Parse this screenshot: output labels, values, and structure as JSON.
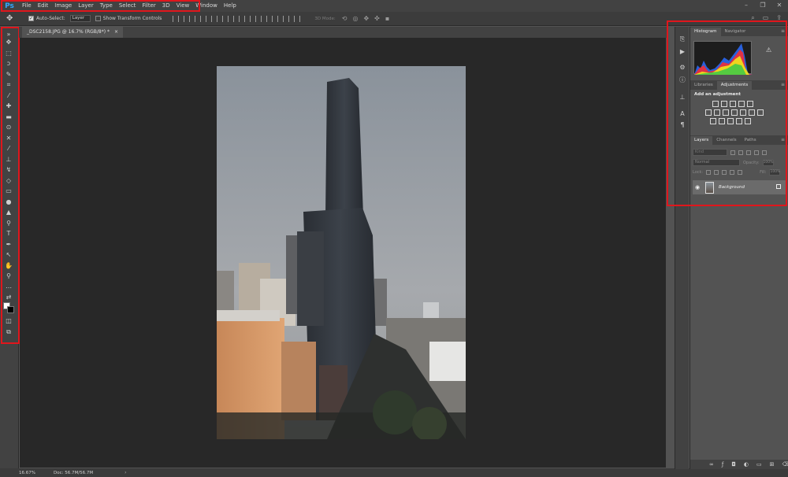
{
  "app": {
    "logo": "Ps"
  },
  "menu": [
    "File",
    "Edit",
    "Image",
    "Layer",
    "Type",
    "Select",
    "Filter",
    "3D",
    "View",
    "Window",
    "Help"
  ],
  "window_controls": [
    "–",
    "❐",
    "✕"
  ],
  "options": {
    "auto_select_label": "Auto-Select:",
    "auto_select_target": "Layer",
    "show_transform_label": "Show Transform Controls",
    "mode_3d_label": "3D Mode:"
  },
  "document": {
    "tab_title": "_DSC2158.JPG @ 16.7% (RGB/8*) *",
    "tab_close": "×"
  },
  "status": {
    "zoom": "16.67%",
    "doc_size": "Doc: 56.7M/56.7M",
    "arrow": "›"
  },
  "panels": {
    "group1_tabs": [
      "Histogram",
      "Navigator"
    ],
    "group2_tabs": [
      "Libraries",
      "Adjustments"
    ],
    "adjustments_title": "Add an adjustment",
    "group3_tabs": [
      "Layers",
      "Channels",
      "Paths"
    ],
    "kind_placeholder": "Kind",
    "blend_mode": "Normal",
    "opacity_label": "Opacity:",
    "opacity_value": "100%",
    "lock_label": "Lock:",
    "fill_label": "Fill:",
    "fill_value": "100%",
    "layer_name": "Background",
    "menu_glyph": "≡",
    "histogram_warning": "⚠"
  },
  "colors": {
    "highlight": "#e0161c",
    "ps_blue": "#31a8ff",
    "foreground": "#ffffff",
    "background": "#000000"
  }
}
